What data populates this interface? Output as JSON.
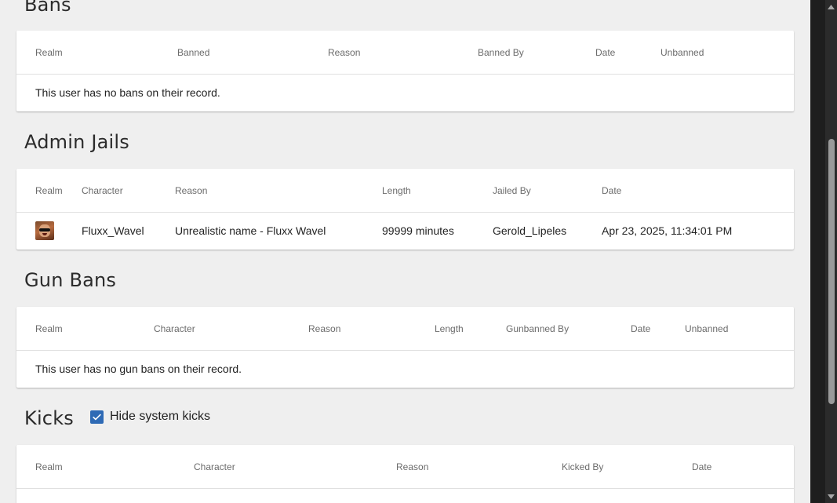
{
  "bans": {
    "title": "Bans",
    "headers": [
      "Realm",
      "Banned",
      "Reason",
      "Banned By",
      "Date",
      "Unbanned"
    ],
    "empty_message": "This user has no bans on their record."
  },
  "admin_jails": {
    "title": "Admin Jails",
    "headers": [
      "Realm",
      "Character",
      "Reason",
      "Length",
      "Jailed By",
      "Date"
    ],
    "rows": [
      {
        "realm_icon": "character-avatar",
        "character": "Fluxx_Wavel",
        "reason": "Unrealistic name - Fluxx Wavel",
        "length": "99999 minutes",
        "jailed_by": "Gerold_Lipeles",
        "date": "Apr 23, 2025, 11:34:01 PM"
      }
    ]
  },
  "gun_bans": {
    "title": "Gun Bans",
    "headers": [
      "Realm",
      "Character",
      "Reason",
      "Length",
      "Gunbanned By",
      "Date",
      "Unbanned"
    ],
    "empty_message": "This user has no gun bans on their record."
  },
  "kicks": {
    "title": "Kicks",
    "hide_system_label": "Hide system kicks",
    "hide_system_checked": true,
    "headers": [
      "Realm",
      "Character",
      "Reason",
      "Kicked By",
      "Date"
    ]
  },
  "colors": {
    "accent": "#2e6ab5",
    "background": "#efefef"
  }
}
